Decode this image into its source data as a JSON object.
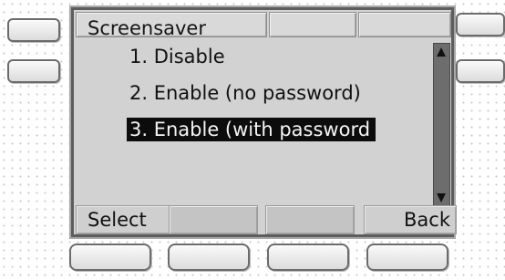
{
  "screen": {
    "title": "Screensaver",
    "menu_items": [
      {
        "label": "1. Disable",
        "selected": false
      },
      {
        "label": "2. Enable (no password)",
        "selected": false
      },
      {
        "label": "3. Enable (with password",
        "selected": true
      }
    ]
  },
  "softkeys": {
    "left_label": "Select",
    "right_label": "Back"
  },
  "icons": {
    "scroll_up": "triangle-up",
    "scroll_down": "triangle-down"
  },
  "colors": {
    "lcd_background": "#d2d2d2",
    "selection": "#0c0c0c",
    "scrollbar": "#6d6d6d"
  }
}
